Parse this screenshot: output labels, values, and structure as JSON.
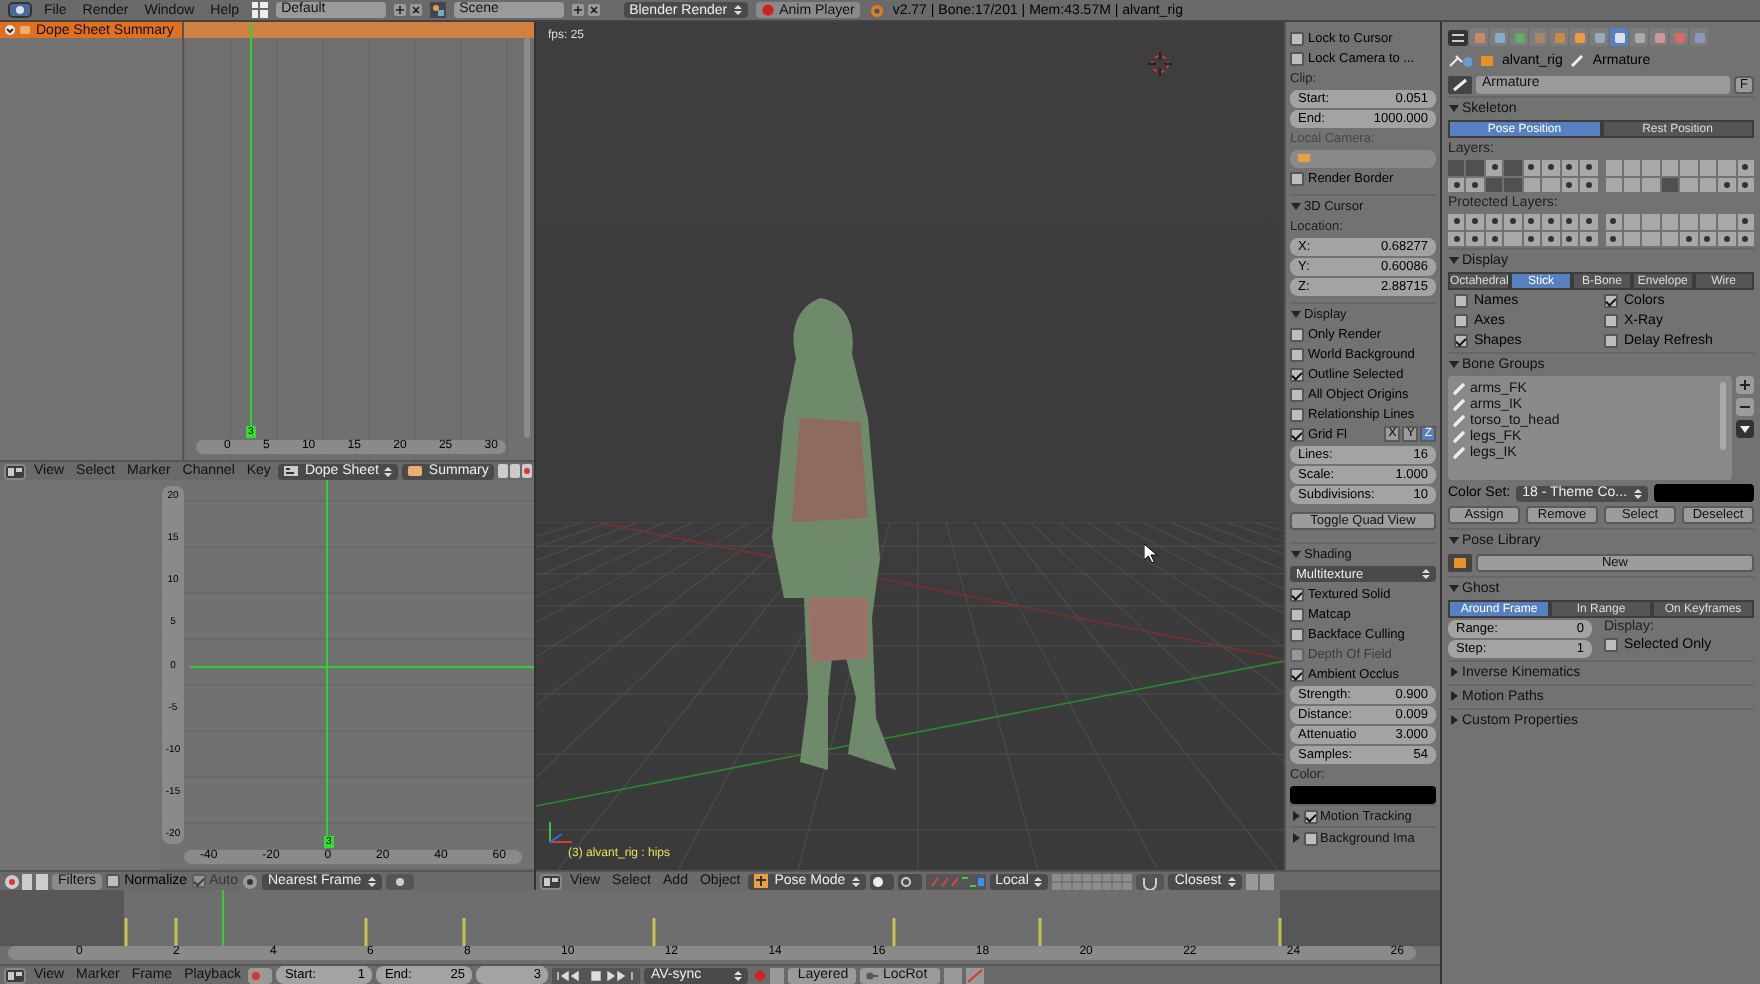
{
  "topbar": {
    "menus": [
      "File",
      "Render",
      "Window",
      "Help"
    ],
    "layout": "Default",
    "scene": "Scene",
    "engine": "Blender Render",
    "player_button": "Anim Player",
    "info": "v2.77 | Bone:17/201 | Mem:43.57M | alvant_rig"
  },
  "dope_sheet": {
    "channels": [
      {
        "label": "Dope Sheet Summary",
        "selected": true
      }
    ],
    "ruler": [
      "0",
      "5",
      "10",
      "15",
      "20",
      "25",
      "30"
    ],
    "current_frame": "3",
    "header": {
      "menus": [
        "View",
        "Select",
        "Marker",
        "Channel",
        "Key"
      ],
      "mode": "Dope Sheet",
      "summary": "Summary"
    }
  },
  "graph_editor": {
    "y_ruler": [
      "20",
      "15",
      "10",
      "5",
      "0",
      "-5",
      "-10",
      "-15",
      "-20"
    ],
    "x_ruler": [
      "-40",
      "-20",
      "0",
      "20",
      "40",
      "60"
    ],
    "current_frame": "3",
    "header": {
      "filters": "Filters",
      "options": [
        {
          "label": "Normalize",
          "checked": false,
          "disabled": false
        },
        {
          "label": "Auto",
          "checked": true,
          "disabled": true
        }
      ],
      "snap": "Nearest Frame"
    }
  },
  "viewport": {
    "fps": "fps: 25",
    "object_info": "(3) alvant_rig : hips",
    "header": {
      "menus": [
        "View",
        "Select",
        "Add",
        "Object"
      ],
      "mode": "Pose Mode",
      "orientation": "Local",
      "snap_target": "Closest"
    }
  },
  "n_panel": [
    {
      "kind": "check",
      "label": "Lock to Cursor",
      "checked": false,
      "disabled": false
    },
    {
      "kind": "check",
      "label": "Lock Camera to ...",
      "checked": false,
      "disabled": false
    },
    {
      "kind": "caption",
      "label": "Clip:",
      "disabled": false
    },
    {
      "kind": "number",
      "label": "Start:",
      "value": "0.051"
    },
    {
      "kind": "number",
      "label": "End:",
      "value": "1000.000"
    },
    {
      "kind": "caption",
      "label": "Local Camera:",
      "disabled": true
    },
    {
      "kind": "empty_field"
    },
    {
      "kind": "check",
      "label": "Render Border",
      "checked": false,
      "disabled": false
    },
    {
      "kind": "section",
      "label": "3D Cursor",
      "expanded": true
    },
    {
      "kind": "caption",
      "label": "Location:",
      "disabled": false
    },
    {
      "kind": "number",
      "label": "X:",
      "value": "0.68277"
    },
    {
      "kind": "number",
      "label": "Y:",
      "value": "0.60086"
    },
    {
      "kind": "number",
      "label": "Z:",
      "value": "2.88715"
    },
    {
      "kind": "section",
      "label": "Display",
      "expanded": true
    },
    {
      "kind": "check",
      "label": "Only Render",
      "checked": false,
      "disabled": false
    },
    {
      "kind": "check",
      "label": "World Background",
      "checked": false,
      "disabled": false
    },
    {
      "kind": "check",
      "label": "Outline Selected",
      "checked": true,
      "disabled": false
    },
    {
      "kind": "check",
      "label": "All Object Origins",
      "checked": false,
      "disabled": false
    },
    {
      "kind": "check",
      "label": "Relationship Lines",
      "checked": false,
      "disabled": false
    },
    {
      "kind": "grid_floor",
      "label": "Grid Fl",
      "checked": true,
      "axes": [
        {
          "label": "X",
          "selected": false
        },
        {
          "label": "Y",
          "selected": false
        },
        {
          "label": "Z",
          "selected": true
        }
      ]
    },
    {
      "kind": "number",
      "label": "Lines:",
      "value": "16"
    },
    {
      "kind": "number",
      "label": "Scale:",
      "value": "1.000"
    },
    {
      "kind": "number",
      "label": "Subdivisions:",
      "value": "10"
    },
    {
      "kind": "button",
      "label": "Toggle Quad View"
    },
    {
      "kind": "section",
      "label": "Shading",
      "expanded": true
    },
    {
      "kind": "dropdown",
      "value": "Multitexture"
    },
    {
      "kind": "check",
      "label": "Textured Solid",
      "checked": true,
      "disabled": false
    },
    {
      "kind": "check",
      "label": "Matcap",
      "checked": false,
      "disabled": false
    },
    {
      "kind": "check",
      "label": "Backface Culling",
      "checked": false,
      "disabled": false
    },
    {
      "kind": "check",
      "label": "Depth Of Field",
      "checked": false,
      "disabled": true
    },
    {
      "kind": "check",
      "label": "Ambient Occlus",
      "checked": true,
      "disabled": false
    },
    {
      "kind": "number",
      "label": "Strength:",
      "value": "0.900"
    },
    {
      "kind": "number",
      "label": "Distance:",
      "value": "0.009"
    },
    {
      "kind": "number",
      "label": "Attenuatio",
      "value": "3.000"
    },
    {
      "kind": "number",
      "label": "Samples:",
      "value": "54"
    },
    {
      "kind": "caption",
      "label": "Color:",
      "disabled": false
    },
    {
      "kind": "swatch"
    },
    {
      "kind": "subpanel",
      "label": "Motion Tracking",
      "checked": true,
      "expanded": false
    },
    {
      "kind": "subpanel",
      "label": "Background Ima",
      "checked": false,
      "expanded": false
    }
  ],
  "properties": {
    "tabs": [
      {
        "selected": false
      },
      {
        "selected": false
      },
      {
        "selected": false
      },
      {
        "selected": false
      },
      {
        "selected": false
      },
      {
        "selected": false
      },
      {
        "selected": false
      },
      {
        "selected": true
      },
      {
        "selected": false
      },
      {
        "selected": false
      },
      {
        "selected": false
      },
      {
        "selected": false
      }
    ],
    "breadcrumb": [
      "alvant_rig",
      "Armature"
    ],
    "datablock": {
      "name": "Armature",
      "fake_user": "F"
    },
    "panels": [
      {
        "kind": "section",
        "label": "Skeleton",
        "expanded": true
      },
      {
        "kind": "segmented",
        "options": [
          {
            "label": "Pose Position",
            "selected": true
          },
          {
            "label": "Rest Position",
            "selected": false
          }
        ]
      },
      {
        "kind": "caption",
        "label": "Layers:"
      },
      {
        "kind": "layers",
        "cells": [
          {
            "on": true,
            "has_bones": false
          },
          {
            "on": true,
            "has_bones": false
          },
          {
            "on": false,
            "has_bones": true
          },
          {
            "on": true,
            "has_bones": false
          },
          {
            "on": false,
            "has_bones": true
          },
          {
            "on": false,
            "has_bones": true
          },
          {
            "on": false,
            "has_bones": true
          },
          {
            "on": false,
            "has_bones": true
          },
          {
            "on": false,
            "has_bones": false
          },
          {
            "on": false,
            "has_bones": false
          },
          {
            "on": false,
            "has_bones": false
          },
          {
            "on": false,
            "has_bones": false
          },
          {
            "on": false,
            "has_bones": false
          },
          {
            "on": false,
            "has_bones": false
          },
          {
            "on": false,
            "has_bones": false
          },
          {
            "on": false,
            "has_bones": true
          },
          {
            "on": false,
            "has_bones": true
          },
          {
            "on": false,
            "has_bones": true
          },
          {
            "on": true,
            "has_bones": false
          },
          {
            "on": true,
            "has_bones": false
          },
          {
            "on": false,
            "has_bones": false
          },
          {
            "on": false,
            "has_bones": false
          },
          {
            "on": false,
            "has_bones": true
          },
          {
            "on": false,
            "has_bones": true
          },
          {
            "on": false,
            "has_bones": false
          },
          {
            "on": false,
            "has_bones": false
          },
          {
            "on": false,
            "has_bones": false
          },
          {
            "on": true,
            "has_bones": false
          },
          {
            "on": false,
            "has_bones": false
          },
          {
            "on": false,
            "has_bones": false
          },
          {
            "on": false,
            "has_bones": true
          },
          {
            "on": false,
            "has_bones": true
          }
        ]
      },
      {
        "kind": "caption",
        "label": "Protected Layers:"
      },
      {
        "kind": "layers",
        "cells": [
          {
            "on": false,
            "has_bones": true
          },
          {
            "on": false,
            "has_bones": true
          },
          {
            "on": false,
            "has_bones": true
          },
          {
            "on": false,
            "has_bones": true
          },
          {
            "on": false,
            "has_bones": true
          },
          {
            "on": false,
            "has_bones": true
          },
          {
            "on": false,
            "has_bones": true
          },
          {
            "on": false,
            "has_bones": true
          },
          {
            "on": false,
            "has_bones": true
          },
          {
            "on": false,
            "has_bones": false
          },
          {
            "on": false,
            "has_bones": false
          },
          {
            "on": false,
            "has_bones": false
          },
          {
            "on": false,
            "has_bones": false
          },
          {
            "on": false,
            "has_bones": false
          },
          {
            "on": false,
            "has_bones": false
          },
          {
            "on": false,
            "has_bones": true
          },
          {
            "on": false,
            "has_bones": true
          },
          {
            "on": false,
            "has_bones": true
          },
          {
            "on": false,
            "has_bones": true
          },
          {
            "on": false,
            "has_bones": false
          },
          {
            "on": false,
            "has_bones": true
          },
          {
            "on": false,
            "has_bones": true
          },
          {
            "on": false,
            "has_bones": true
          },
          {
            "on": false,
            "has_bones": true
          },
          {
            "on": false,
            "has_bones": true
          },
          {
            "on": false,
            "has_bones": false
          },
          {
            "on": false,
            "has_bones": false
          },
          {
            "on": false,
            "has_bones": false
          },
          {
            "on": false,
            "has_bones": true
          },
          {
            "on": false,
            "has_bones": true
          },
          {
            "on": false,
            "has_bones": true
          },
          {
            "on": false,
            "has_bones": true
          }
        ]
      },
      {
        "kind": "section",
        "label": "Display",
        "expanded": true
      },
      {
        "kind": "segmented",
        "options": [
          {
            "label": "Octahedral",
            "selected": false
          },
          {
            "label": "Stick",
            "selected": true
          },
          {
            "label": "B-Bone",
            "selected": false
          },
          {
            "label": "Envelope",
            "selected": false
          },
          {
            "label": "Wire",
            "selected": false
          }
        ]
      },
      {
        "kind": "checks",
        "items": [
          {
            "label": "Names",
            "checked": false
          },
          {
            "label": "Colors",
            "checked": true
          },
          {
            "label": "Axes",
            "checked": false
          },
          {
            "label": "X-Ray",
            "checked": false
          },
          {
            "label": "Shapes",
            "checked": true
          },
          {
            "label": "Delay Refresh",
            "checked": false
          }
        ]
      },
      {
        "kind": "section",
        "label": "Bone Groups",
        "expanded": true
      },
      {
        "kind": "list",
        "items": [
          "arms_FK",
          "arms_IK",
          "torso_to_head",
          "legs_FK",
          "legs_IK"
        ]
      },
      {
        "kind": "color_set",
        "label": "Color Set:",
        "value": "18 - Theme Co..."
      },
      {
        "kind": "buttons",
        "items": [
          "Assign",
          "Remove",
          "Select",
          "Deselect"
        ]
      },
      {
        "kind": "section",
        "label": "Pose Library",
        "expanded": true
      },
      {
        "kind": "new_button",
        "label": "New"
      },
      {
        "kind": "section",
        "label": "Ghost",
        "expanded": true
      },
      {
        "kind": "segmented",
        "options": [
          {
            "label": "Around Frame",
            "selected": true
          },
          {
            "label": "In Range",
            "selected": false
          },
          {
            "label": "On Keyframes",
            "selected": false
          }
        ]
      },
      {
        "kind": "ghost",
        "fields": [
          {
            "label": "Range:",
            "value": "0"
          },
          {
            "label": "Step:",
            "value": "1"
          }
        ],
        "caption": "Display:",
        "check": {
          "label": "Selected Only",
          "checked": false
        }
      },
      {
        "kind": "section",
        "label": "Inverse Kinematics",
        "expanded": false
      },
      {
        "kind": "section",
        "label": "Motion Paths",
        "expanded": false
      },
      {
        "kind": "section",
        "label": "Custom Properties",
        "expanded": false
      }
    ]
  },
  "timeline": {
    "ruler": [
      "0",
      "2",
      "4",
      "6",
      "8",
      "10",
      "12",
      "14",
      "16",
      "18",
      "20",
      "22",
      "24",
      "26"
    ],
    "header": {
      "menus": [
        "View",
        "Marker",
        "Frame",
        "Playback"
      ],
      "start": {
        "label": "Start:",
        "value": "1"
      },
      "end": {
        "label": "End:",
        "value": "25"
      },
      "frame": "3",
      "sync": "AV-sync",
      "keying": "Layered",
      "keying_set": "LocRot"
    }
  }
}
